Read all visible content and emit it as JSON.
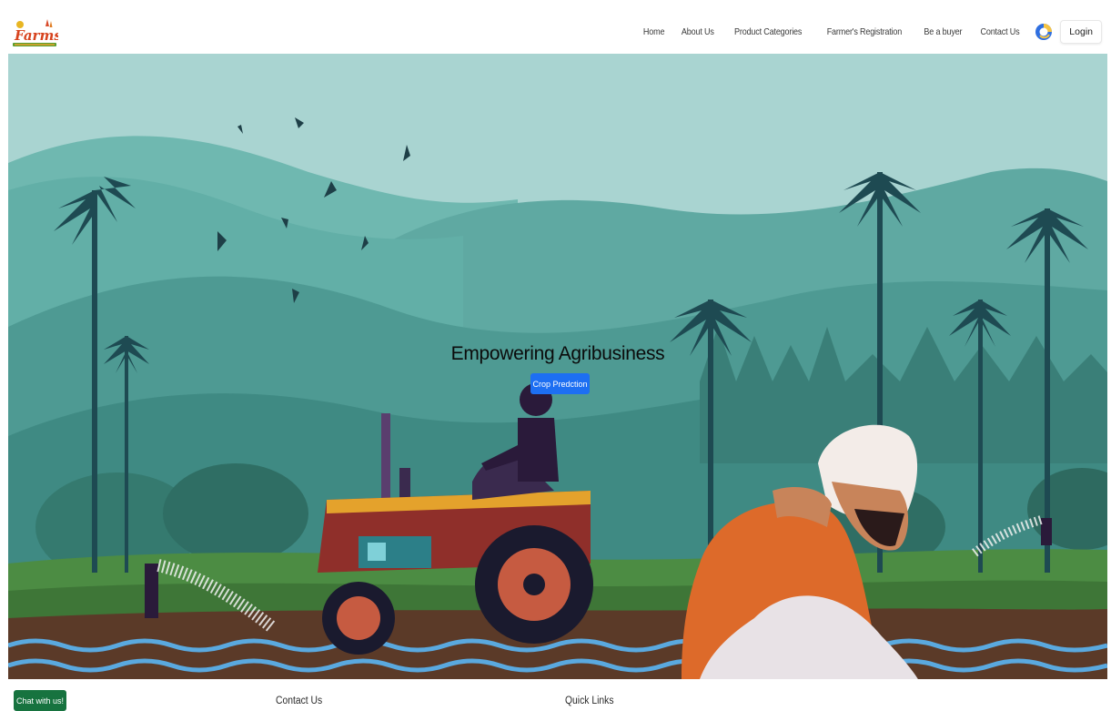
{
  "navbar": {
    "logo_text": "Farmse",
    "links": [
      "Home",
      "About Us",
      "Product Categories",
      "Farmer's Registration",
      "Be a buyer",
      "Contact Us"
    ],
    "theme_icon": "theme-toggle-icon",
    "login_label": "Login"
  },
  "hero": {
    "title": "Empowering Agribusiness",
    "button_label": "Crop Predction",
    "button_color": "#1d6ff2"
  },
  "footer": {
    "chat_label": "Chat with us!",
    "chat_color": "#17733f",
    "contact_heading": "Contact Us",
    "links_heading": "Quick Links"
  }
}
